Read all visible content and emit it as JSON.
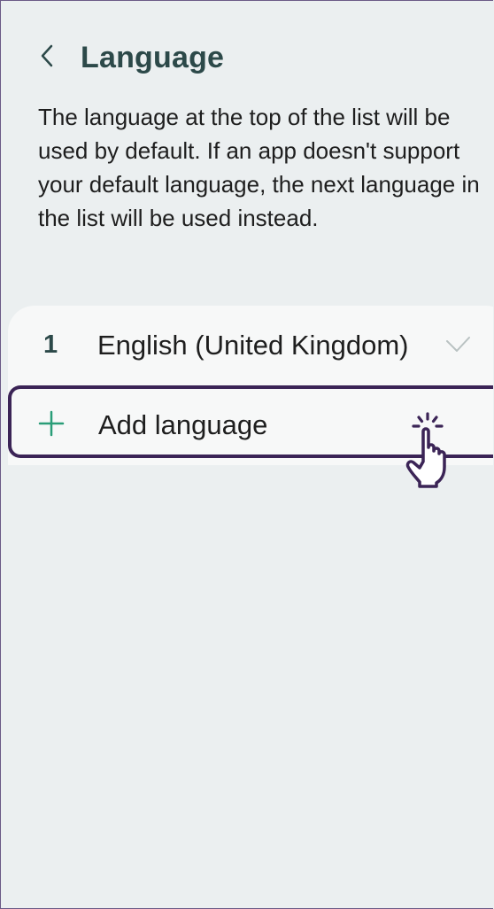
{
  "header": {
    "title": "Language",
    "back_icon": "chevron-left-icon"
  },
  "description": "The language at the top of the list will be used by default. If an app doesn't support your default language, the next language in the list will be used instead.",
  "languages": [
    {
      "index": "1",
      "name": "English (United Kingdom)",
      "status_icon": "check-icon"
    }
  ],
  "add_language": {
    "label": "Add language",
    "icon": "plus-icon"
  },
  "cursor": {
    "icon": "tap-hand-icon"
  },
  "colors": {
    "background": "#ebeff0",
    "card": "#f7f8f8",
    "title": "#2c4949",
    "accent_green": "#2a9d78",
    "highlight_border": "#3b2456",
    "check": "#b9c2c2"
  }
}
